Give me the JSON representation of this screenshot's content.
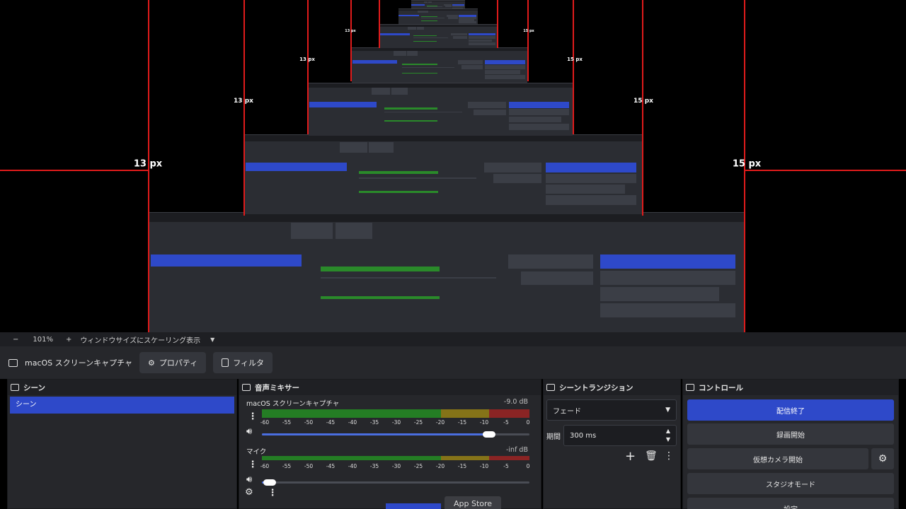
{
  "guide_labels": {
    "left": "13 px",
    "right": "15 px"
  },
  "status": {
    "zoom_minus": "−",
    "zoom": "101%",
    "zoom_plus": "+",
    "scale_mode": "ウィンドウサイズにスケーリング表示",
    "dropdown": "▼"
  },
  "source": {
    "name": "macOS スクリーンキャプチャ",
    "properties": "プロパティ",
    "filters": "フィルタ"
  },
  "scenes": {
    "title": "シーン",
    "items": [
      "シーン"
    ]
  },
  "mixer": {
    "title": "音声ミキサー",
    "tracks": [
      {
        "name": "macOS スクリーンキャプチャ",
        "db": "-9.0 dB",
        "volume": 0.85
      },
      {
        "name": "マイク",
        "db": "-inf dB",
        "volume": 0.03
      }
    ],
    "ticks": [
      "-60",
      "-55",
      "-50",
      "-45",
      "-40",
      "-35",
      "-30",
      "-25",
      "-20",
      "-15",
      "-10",
      "-5",
      "0"
    ]
  },
  "transitions": {
    "title": "シーントランジション",
    "selected": "フェード",
    "duration_label": "期間",
    "duration": "300 ms"
  },
  "controls": {
    "title": "コントロール",
    "stop_stream": "配信終了",
    "start_record": "録画開始",
    "virtual_cam": "仮想カメラ開始",
    "studio_mode": "スタジオモード",
    "settings": "設定"
  },
  "app_store": "App Store",
  "colors": {
    "accent": "#2e49c9",
    "guide": "#e01b1b",
    "meter_green": "#247d24",
    "meter_yellow": "#857318",
    "meter_red": "#8a2424"
  }
}
